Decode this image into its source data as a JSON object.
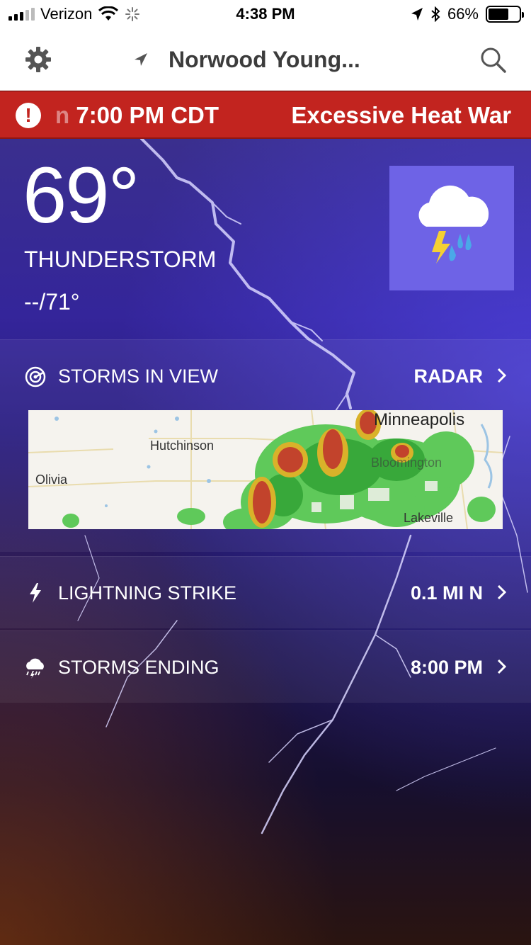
{
  "status_bar": {
    "carrier": "Verizon",
    "time": "4:38 PM",
    "battery": "66%",
    "battery_level": 0.66,
    "icons": [
      "signal-icon",
      "wifi-icon",
      "activity-icon",
      "location-arrow-icon",
      "bluetooth-icon",
      "battery-icon"
    ]
  },
  "header": {
    "location": "Norwood Young...",
    "icons": [
      "gear-icon",
      "location-arrow-icon",
      "search-icon"
    ]
  },
  "alert": {
    "text_faded": "n",
    "text_main": "7:00 PM CDT",
    "text_next": "Excessive Heat War",
    "icon": "alert-icon"
  },
  "current": {
    "temperature": "69°",
    "condition": "THUNDERSTORM",
    "hi_lo": "--/71°",
    "condition_icon": "thunderstorm-icon"
  },
  "storms_in_view": {
    "label": "STORMS IN VIEW",
    "action": "RADAR",
    "icon": "radar-icon",
    "map": {
      "labels": {
        "minneapolis": "Minneapolis",
        "hutchinson": "Hutchinson",
        "olivia": "Olivia",
        "bloomington": "Bloomington",
        "lakeville": "Lakeville"
      }
    }
  },
  "lightning": {
    "label": "LIGHTNING STRIKE",
    "value": "0.1 MI N",
    "icon": "lightning-icon"
  },
  "storms_ending": {
    "label": "STORMS ENDING",
    "value": "8:00 PM",
    "icon": "storm-cloud-icon"
  },
  "colors": {
    "alert_red": "#c2241f",
    "tile_purple": "#6e63e6",
    "bolt_yellow": "#f5d033",
    "rain_blue": "#4aa8e8"
  }
}
